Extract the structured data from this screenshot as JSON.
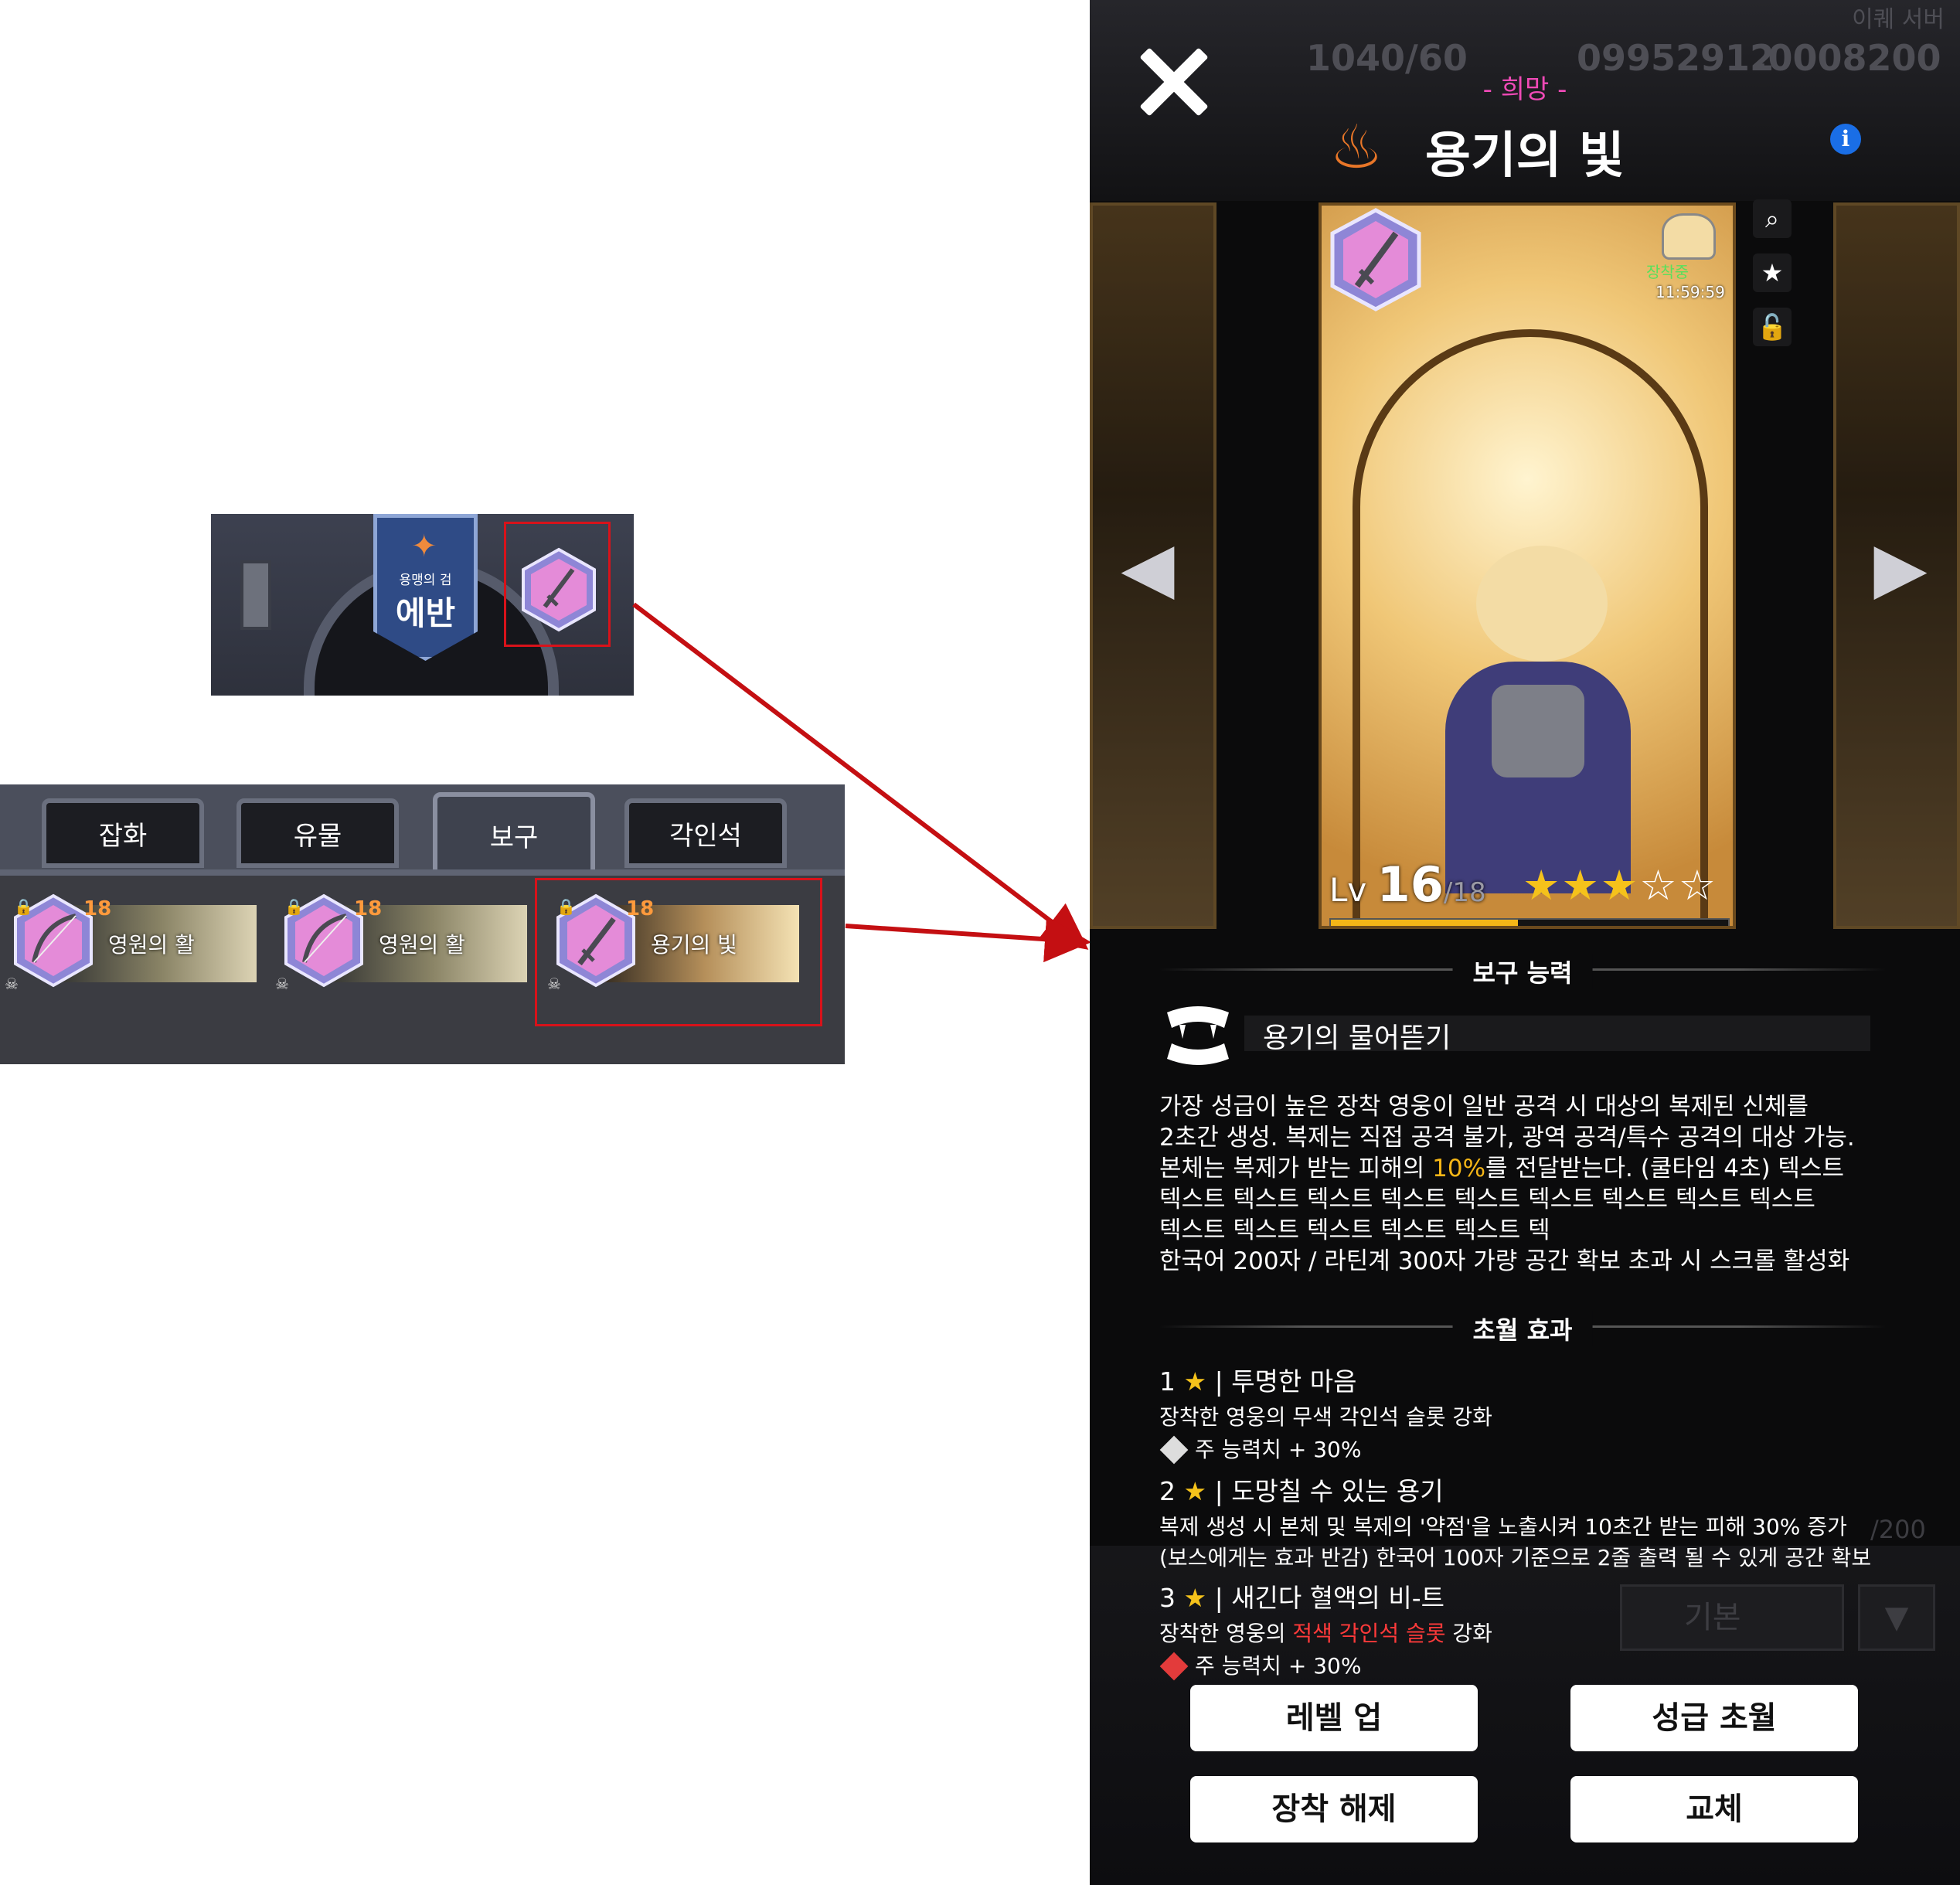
{
  "snippet_header": {
    "hero_title": "용맹의 검",
    "hero_name": "에반"
  },
  "inventory": {
    "tabs": [
      "잡화",
      "유물",
      "보구",
      "각인석"
    ],
    "active_tab": "보구",
    "items": [
      {
        "name": "영원의 활",
        "level": "18"
      },
      {
        "name": "영원의 활",
        "level": "18"
      },
      {
        "name": "용기의 빛",
        "level": "18"
      }
    ]
  },
  "detail": {
    "server": "이퀘 서버",
    "resources": {
      "stamina": "1040/60",
      "gold": "09952912",
      "gems": ".0008200"
    },
    "grade_label": "- 희망 -",
    "title": "용기의 빛",
    "card": {
      "equipped_label": "장착중",
      "timer": "11:59:59",
      "level_prefix": "Lv",
      "level": "16",
      "level_max": "/18",
      "stars_filled": 3,
      "stars_total": 5,
      "exp_fraction": 0.47
    },
    "ability_section": "보구 능력",
    "ability_name": "용기의 물어뜯기",
    "description": {
      "line1": "가장 성급이 높은 장착 영웅이 일반 공격 시 대상의 복제된 신체를",
      "line2": "2초간 생성. 복제는 직접 공격 불가, 광역 공격/특수 공격의 대상 가능.",
      "line3_pre": "본체는 복제가 받는 피해의 ",
      "line3_hl": "10%",
      "line3_post": "를 전달받는다. (쿨타임 4초) 텍스트",
      "line4": "텍스트 텍스트 텍스트 텍스트 텍스트 텍스트 텍스트 텍스트 텍스트",
      "line5": "텍스트 텍스트 텍스트 텍스트 텍스트 텍",
      "line6": "한국어 200자 / 라틴계 300자 가량 공간 확보 초과 시 스크롤 활성화"
    },
    "transcend_section": "초월 효과",
    "transcend": [
      {
        "num": "1",
        "star": "★",
        "title": "| 투명한 마음",
        "desc": "장착한 영웅의 무색 각인석 슬롯 강화",
        "stat": "주 능력치 + 30%"
      },
      {
        "num": "2",
        "star": "★",
        "title": "| 도망칠 수 있는 용기",
        "desc": "복제 생성 시 본체 및 복제의 '약점'을 노출시켜 10초간 받는 피해 30% 증가",
        "desc2": "(보스에게는 효과 반감) 한국어 100자 기준으로 2줄 출력 될 수 있게 공간 확보"
      },
      {
        "num": "3",
        "star": "★",
        "title": "| 새긴다 혈액의 비-트",
        "desc_pre": "장착한 영웅의 ",
        "desc_red": "적색 각인석 슬롯",
        "desc_post": " 강화",
        "stat": "주 능력치 + 30%"
      }
    ],
    "bg_ghost": {
      "count": "/200",
      "select": "기본"
    },
    "buttons": {
      "level_up": "레벨 업",
      "grade_up": "성급 초월",
      "unequip": "장착 해제",
      "swap": "교체"
    },
    "colors": {
      "grade": "#f04ab7",
      "highlight": "#f5b617",
      "red_text": "#ff3a3a",
      "star": "#f5c21b"
    }
  }
}
